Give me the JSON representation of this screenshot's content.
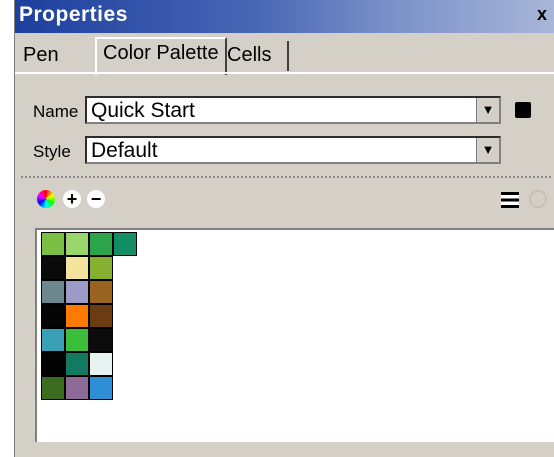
{
  "window": {
    "title": "Properties",
    "close_glyph": "x"
  },
  "tabs": [
    {
      "label": "Pen"
    },
    {
      "label": "Color Palette"
    },
    {
      "label": "Cells"
    }
  ],
  "fields": {
    "name_label": "Name",
    "name_value": "Quick Start",
    "style_label": "Style",
    "style_value": "Default"
  },
  "toolbar": {
    "icons": [
      "color-wheel-icon",
      "add-icon",
      "remove-icon",
      "list-view-icon",
      "disabled-option-icon"
    ]
  },
  "swatches": {
    "top_row_colors": [
      "#7bbf44",
      "#9ad66b",
      "#2ca54a",
      "#128e66"
    ],
    "grid_colors": [
      [
        "#0a0a0a",
        "#f3e39c",
        "#86b030"
      ],
      [
        "#6d8790",
        "#9c9ac6",
        "#9a6320"
      ],
      [
        "#050505",
        "#ff7a00",
        "#6b3b12"
      ],
      [
        "#3aa0b7",
        "#3bbf3b",
        "#0c0c0c"
      ],
      [
        "#030303",
        "#137a62",
        "#e7f3f0"
      ],
      [
        "#3c6c20",
        "#8f6a97",
        "#2f8fd6"
      ]
    ]
  }
}
